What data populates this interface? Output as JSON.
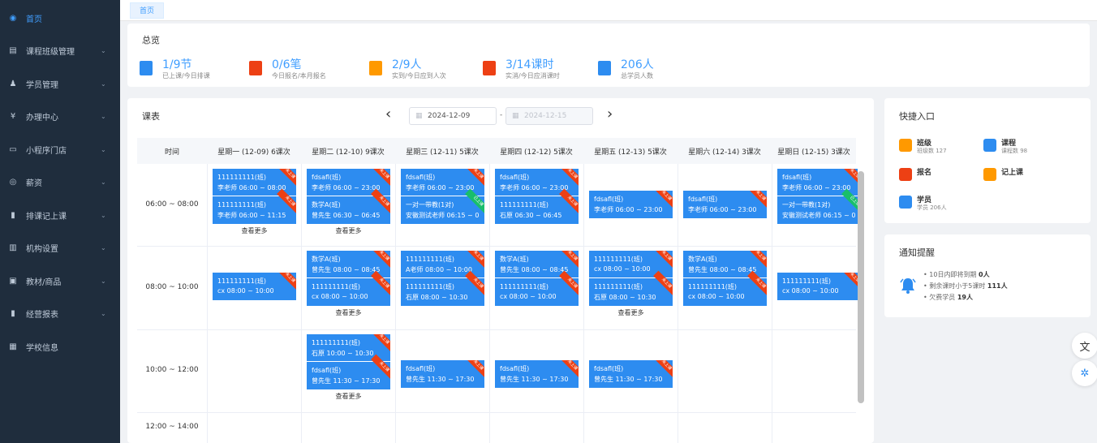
{
  "sidebar": {
    "items": [
      {
        "label": "首页",
        "icon": "dashboard-icon",
        "active": true
      },
      {
        "label": "课程班级管理",
        "icon": "course-icon",
        "arrow": true
      },
      {
        "label": "学员管理",
        "icon": "users-icon",
        "arrow": true
      },
      {
        "label": "办理中心",
        "icon": "yen-icon",
        "arrow": true
      },
      {
        "label": "小程序门店",
        "icon": "monitor-icon",
        "arrow": true
      },
      {
        "label": "薪资",
        "icon": "salary-icon",
        "arrow": true
      },
      {
        "label": "排课记上课",
        "icon": "schedule-icon",
        "arrow": true
      },
      {
        "label": "机构设置",
        "icon": "settings-icon",
        "arrow": true
      },
      {
        "label": "教材/商品",
        "icon": "box-icon",
        "arrow": true
      },
      {
        "label": "经营报表",
        "icon": "chart-icon",
        "arrow": true
      },
      {
        "label": "学校信息",
        "icon": "grid-icon",
        "arrow": false
      }
    ]
  },
  "tabs": {
    "home": "首页"
  },
  "overview": {
    "title": "总览",
    "stats": [
      {
        "value": "1/9节",
        "label": "已上课/今日排课",
        "icon": "bookmark-icon",
        "color": "#2d8cf0"
      },
      {
        "value": "0/6笔",
        "label": "今日报名/本月报名",
        "icon": "clipboard-icon",
        "color": "#ed4014"
      },
      {
        "value": "2/9人",
        "label": "实到/今日应到人次",
        "icon": "person-icon",
        "color": "#ff9900"
      },
      {
        "value": "3/14课时",
        "label": "实消/今日应消课时",
        "icon": "book-icon",
        "color": "#ed4014"
      },
      {
        "value": "206人",
        "label": "总学员人数",
        "icon": "student-icon",
        "color": "#2d8cf0"
      }
    ]
  },
  "schedule": {
    "title": "课表",
    "start_date": "2024-12-09",
    "end_date": "2024-12-15",
    "time_header": "时间",
    "days": [
      "星期一 (12-09) 6课次",
      "星期二 (12-10) 9课次",
      "星期三 (12-11) 5课次",
      "星期四 (12-12) 5课次",
      "星期五 (12-13) 5课次",
      "星期六 (12-14) 3课次",
      "星期日 (12-15) 3课次"
    ],
    "slots": [
      "06:00 ~ 08:00",
      "08:00 ~ 10:00",
      "10:00 ~ 12:00",
      "12:00 ~ 14:00"
    ],
    "more_label": "查看更多",
    "ribbon": "未上课",
    "ribbon_green": "已上课",
    "cards": [
      {
        "day": 0,
        "slot": 0,
        "items": [
          [
            "111111111(班)",
            "李老师 06:00 ~ 08:00"
          ],
          [
            "111111111(班)",
            "李老师 06:00 ~ 11:15"
          ]
        ],
        "more": true
      },
      {
        "day": 1,
        "slot": 0,
        "items": [
          [
            "fdsafl(班)",
            "李老师 06:00 ~ 23:00"
          ],
          [
            "数学A(班)",
            "曾先生 06:30 ~ 06:45"
          ]
        ],
        "more": true
      },
      {
        "day": 2,
        "slot": 0,
        "items": [
          [
            "fdsafl(班)",
            "李老师 06:00 ~ 23:00"
          ],
          [
            "一对一带教(1对)",
            "安徽测试老师 06:15 ~ 0"
          ]
        ],
        "green2": true
      },
      {
        "day": 3,
        "slot": 0,
        "items": [
          [
            "fdsafl(班)",
            "李老师 06:00 ~ 23:00"
          ],
          [
            "111111111(班)",
            "石原 06:30 ~ 06:45"
          ]
        ]
      },
      {
        "day": 4,
        "slot": 0,
        "items": [
          [
            "fdsafl(班)",
            "李老师 06:00 ~ 23:00"
          ]
        ]
      },
      {
        "day": 5,
        "slot": 0,
        "items": [
          [
            "fdsafl(班)",
            "李老师 06:00 ~ 23:00"
          ]
        ]
      },
      {
        "day": 6,
        "slot": 0,
        "items": [
          [
            "fdsafl(班)",
            "李老师 06:00 ~ 23:00"
          ],
          [
            "一对一带教(1对)",
            "安徽测试老师 06:15 ~ 0"
          ]
        ],
        "green2": true
      },
      {
        "day": 0,
        "slot": 1,
        "items": [
          [
            "111111111(班)",
            "cx 08:00 ~ 10:00"
          ]
        ]
      },
      {
        "day": 1,
        "slot": 1,
        "items": [
          [
            "数学A(班)",
            "曾先生 08:00 ~ 08:45"
          ],
          [
            "111111111(班)",
            "cx 08:00 ~ 10:00"
          ]
        ],
        "more": true
      },
      {
        "day": 2,
        "slot": 1,
        "items": [
          [
            "111111111(班)",
            "A老师 08:00 ~ 10:00"
          ],
          [
            "111111111(班)",
            "石原 08:00 ~ 10:30"
          ]
        ]
      },
      {
        "day": 3,
        "slot": 1,
        "items": [
          [
            "数学A(班)",
            "曾先生 08:00 ~ 08:45"
          ],
          [
            "111111111(班)",
            "cx 08:00 ~ 10:00"
          ]
        ]
      },
      {
        "day": 4,
        "slot": 1,
        "items": [
          [
            "111111111(班)",
            "cx 08:00 ~ 10:00"
          ],
          [
            "111111111(班)",
            "石原 08:00 ~ 10:30"
          ]
        ],
        "more": true
      },
      {
        "day": 5,
        "slot": 1,
        "items": [
          [
            "数学A(班)",
            "曾先生 08:00 ~ 08:45"
          ],
          [
            "111111111(班)",
            "cx 08:00 ~ 10:00"
          ]
        ]
      },
      {
        "day": 6,
        "slot": 1,
        "items": [
          [
            "111111111(班)",
            "cx 08:00 ~ 10:00"
          ]
        ]
      },
      {
        "day": 1,
        "slot": 2,
        "items": [
          [
            "111111111(班)",
            "石原 10:00 ~ 10:30"
          ],
          [
            "fdsafl(班)",
            "曾先生 11:30 ~ 17:30"
          ]
        ],
        "more": true
      },
      {
        "day": 2,
        "slot": 2,
        "items": [
          [
            "fdsafl(班)",
            "曾先生 11:30 ~ 17:30"
          ]
        ]
      },
      {
        "day": 3,
        "slot": 2,
        "items": [
          [
            "fdsafl(班)",
            "曾先生 11:30 ~ 17:30"
          ]
        ]
      },
      {
        "day": 4,
        "slot": 2,
        "items": [
          [
            "fdsafl(班)",
            "曾先生 11:30 ~ 17:30"
          ]
        ]
      }
    ]
  },
  "quick": {
    "title": "快捷入口",
    "items": [
      {
        "name": "班级",
        "sub": "班级数 127",
        "icon": "class-icon",
        "color": "#ff9900"
      },
      {
        "name": "课程",
        "sub": "课程数 98",
        "icon": "course-book-icon",
        "color": "#2d8cf0"
      },
      {
        "name": "报名",
        "sub": "",
        "icon": "signup-icon",
        "color": "#ed4014"
      },
      {
        "name": "记上课",
        "sub": "",
        "icon": "attend-icon",
        "color": "#ff9900"
      },
      {
        "name": "学员",
        "sub": "学员 206人",
        "icon": "student-icon",
        "color": "#2d8cf0"
      }
    ]
  },
  "notice": {
    "title": "通知提醒",
    "lines": [
      {
        "text": "10日内即将到期",
        "num": "0人"
      },
      {
        "text": "剩余课时小于5课时",
        "num": "111人"
      },
      {
        "text": "欠费学员",
        "num": "19人"
      }
    ]
  },
  "float": {
    "translate": "文",
    "network": "✲"
  }
}
